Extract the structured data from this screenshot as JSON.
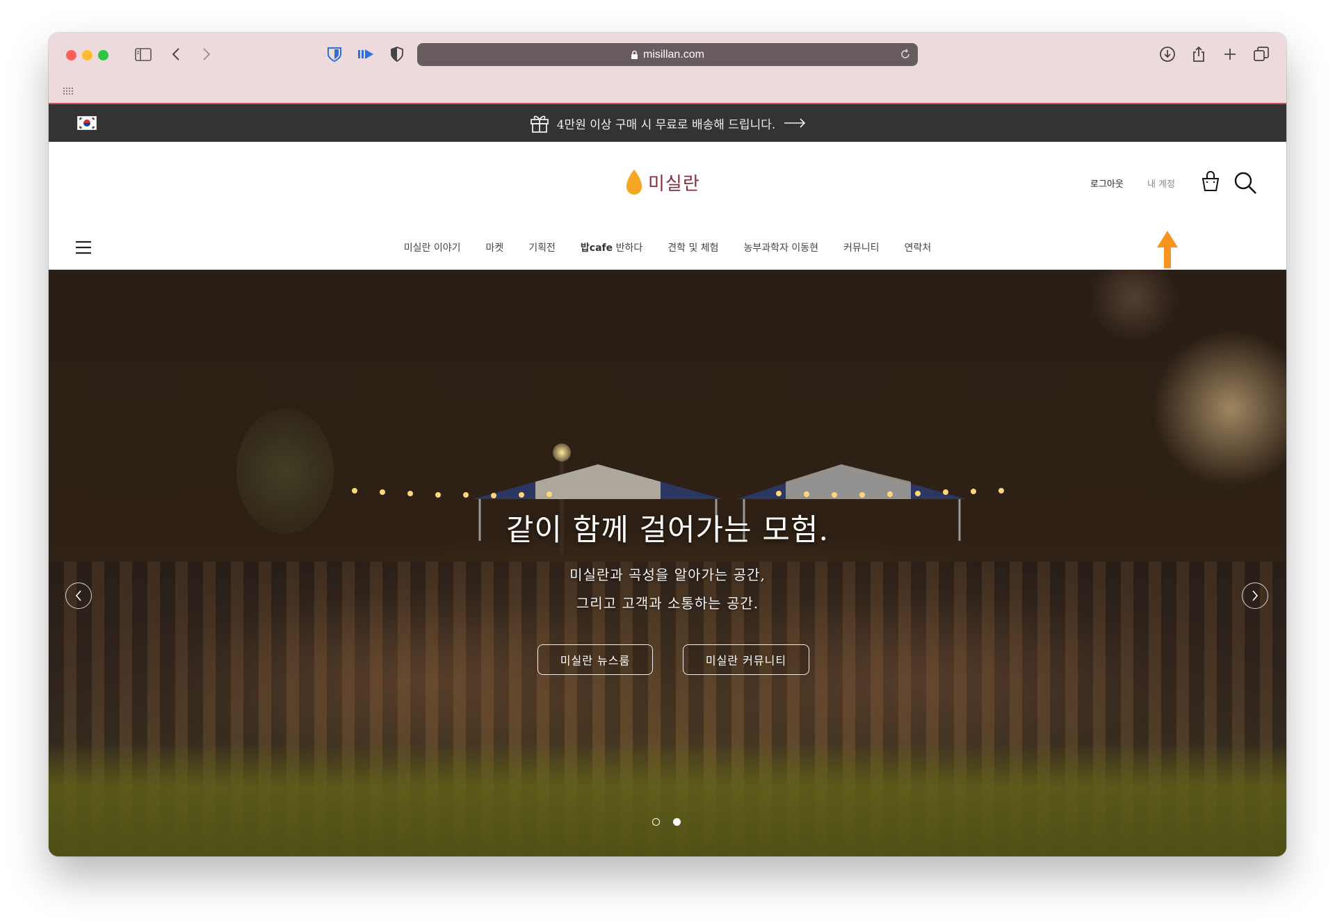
{
  "browser": {
    "url": "misillan.com",
    "icons": [
      "sidebar-icon",
      "back-icon",
      "forward-icon",
      "bitwarden-icon",
      "extension-play-icon",
      "privacy-shield-icon",
      "lock-icon",
      "reload-icon",
      "download-icon",
      "share-icon",
      "new-tab-icon",
      "tabs-overview-icon",
      "apps-grid-icon"
    ]
  },
  "promo": {
    "text": "4만원 이상 구매 시 무료로 배송해 드립니다."
  },
  "header": {
    "logo_text": "미실란",
    "logout": "로그아웃",
    "account": "내 계정"
  },
  "nav": {
    "items": [
      {
        "label": "미실란 이야기"
      },
      {
        "label": "마켓"
      },
      {
        "label": "기획전"
      },
      {
        "label_bold": "밥cafe",
        "label": " 반하다"
      },
      {
        "label": "견학 및 체험"
      },
      {
        "label": "농부과학자 이동현"
      },
      {
        "label": "커뮤니티"
      },
      {
        "label": "연락처"
      }
    ]
  },
  "hero": {
    "title": "같이 함께 걸어가는 모험.",
    "subtitle_line1": "미실란과 곡성을 알아가는 공간,",
    "subtitle_line2": "그리고 고객과 소통하는 공간.",
    "button_news": "미실란 뉴스룸",
    "button_community": "미실란 커뮤니티",
    "active_slide": 2,
    "slide_count": 2
  },
  "colors": {
    "chrome_bg": "#ecdadd",
    "url_bar_bg": "#695c5e",
    "promo_bg": "#333333",
    "logo_text": "#8a2c3c",
    "logo_drop": "#f5a623",
    "annotation_arrow": "#f7931e"
  }
}
